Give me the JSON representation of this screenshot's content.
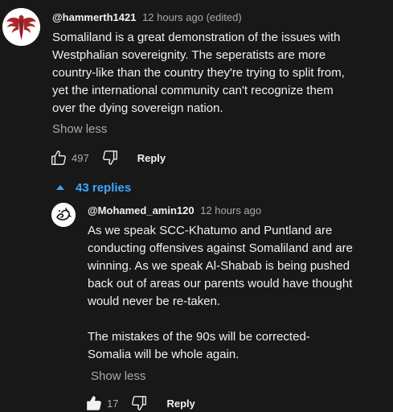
{
  "comment": {
    "author": "@hammerth1421",
    "meta": "12 hours ago (edited)",
    "text": "Somaliland is a great demonstration of the issues with\nWestphalian sovereignity. The seperatists are more\ncountry-like than the country they're trying to split from,\nyet the international community can't recognize them\nover the dying sovereign nation.",
    "show_less_label": "Show less",
    "like_count": "497",
    "reply_label": "Reply"
  },
  "replies": {
    "toggle_label": "43 replies"
  },
  "reply": {
    "author": "@Mohamed_amin120",
    "meta": "12 hours ago",
    "text": "As we speak SCC-Khatumo and Puntland are\nconducting offensives against Somaliland and are\nwinning. As we speak Al-Shabab is being pushed\nback out of areas our parents would have thought\nwould never be re-taken.\n\nThe mistakes of the 90s will be corrected-\nSomalia will be whole again.",
    "show_less_label": "Show less",
    "like_count": "17",
    "reply_label": "Reply"
  },
  "colors": {
    "background": "#181818",
    "text": "#f1f1f1",
    "secondary_text": "#aaaaaa",
    "link_blue": "#3ea6ff",
    "avatar_emblem_red": "#a8262b"
  },
  "icons": {
    "like": "thumbs-up-icon",
    "dislike": "thumbs-down-icon",
    "replies_caret": "caret-up-icon"
  }
}
